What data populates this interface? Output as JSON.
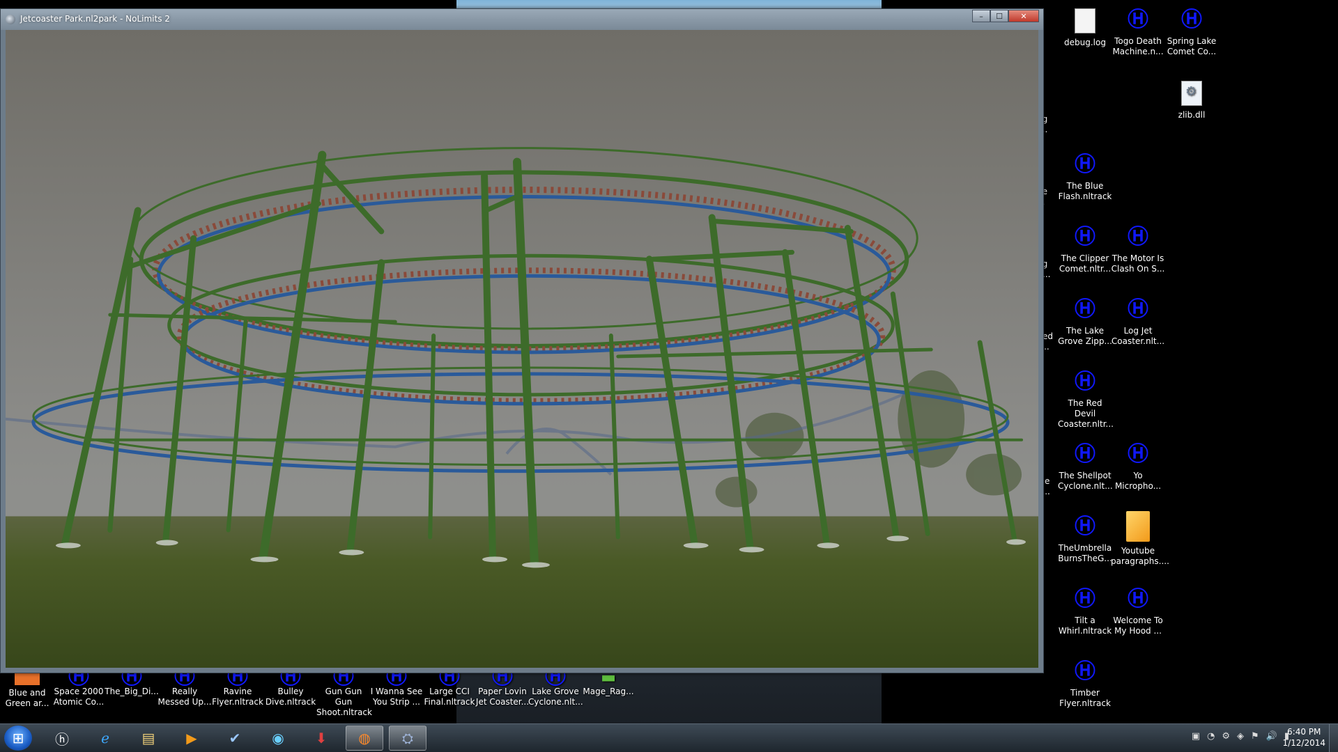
{
  "window": {
    "title": "Jetcoaster Park.nl2park - NoLimits 2",
    "controls": {
      "minimize": "–",
      "maximize": "☐",
      "close": "✕"
    }
  },
  "desktop_right": [
    {
      "label": "debug.log",
      "icon": "file-icon"
    },
    {
      "label": "Togo Death Machine.n...",
      "icon": "nltrack-icon"
    },
    {
      "label": "Spring Lake Comet Co...",
      "icon": "nltrack-icon"
    },
    {
      "label": "zlib.dll",
      "icon": "dll-icon"
    },
    {
      "label": "The Blue Flash.nltrack",
      "icon": "nltrack-icon"
    },
    {
      "label": "The Clipper Comet.nltr...",
      "icon": "nltrack-icon"
    },
    {
      "label": "The Motor Is Clash On S...",
      "icon": "nltrack-icon"
    },
    {
      "label": "The Lake Grove Zipp...",
      "icon": "nltrack-icon"
    },
    {
      "label": "Log Jet Coaster.nlt...",
      "icon": "nltrack-icon"
    },
    {
      "label": "The Red Devil Coaster.nltr...",
      "icon": "nltrack-icon"
    },
    {
      "label": "The Shellpot Cyclone.nlt...",
      "icon": "nltrack-icon"
    },
    {
      "label": "Yo Micropho...",
      "icon": "nltrack-icon"
    },
    {
      "label": "TheUmbrella BurnsTheG...",
      "icon": "nltrack-icon"
    },
    {
      "label": "Youtube paragraphs....",
      "icon": "document-icon"
    },
    {
      "label": "Tilt a Whirl.nltrack",
      "icon": "nltrack-icon"
    },
    {
      "label": "Welcome To My Hood ...",
      "icon": "nltrack-icon"
    },
    {
      "label": "Timber Flyer.nltrack",
      "icon": "nltrack-icon"
    }
  ],
  "desktop_bottom": [
    {
      "label": "Blue and Green ar...",
      "icon": "folder-orange-icon"
    },
    {
      "label": "Space 2000 Atomic Co...",
      "icon": "nltrack-icon"
    },
    {
      "label": "The_Big_Di...",
      "icon": "nltrack-icon"
    },
    {
      "label": "Really Messed Up...",
      "icon": "nltrack-icon"
    },
    {
      "label": "Ravine Flyer.nltrack",
      "icon": "nltrack-icon"
    },
    {
      "label": "Bulley Dive.nltrack",
      "icon": "nltrack-icon"
    },
    {
      "label": "Gun Gun Gun Shoot.nltrack",
      "icon": "nltrack-icon"
    },
    {
      "label": "I Wanna See You Strip ...",
      "icon": "nltrack-icon"
    },
    {
      "label": "Large CCI Final.nltrack",
      "icon": "nltrack-icon"
    },
    {
      "label": "Paper Lovin Jet Coaster...",
      "icon": "nltrack-icon"
    },
    {
      "label": "Lake Grove Cyclone.nlt...",
      "icon": "nltrack-icon"
    },
    {
      "label": "Mage_Rag...",
      "icon": "nltrack-icon"
    }
  ],
  "desktop_cutoff": [
    "ng r...",
    "ne ...",
    "ng lt...",
    "ited s...",
    "ide e..."
  ],
  "taskbar": {
    "start_glyph": "⊞",
    "pinned": [
      {
        "name": "hp-icon",
        "glyph": "ⓗ"
      },
      {
        "name": "internet-explorer-icon",
        "glyph": "ℯ"
      },
      {
        "name": "file-explorer-icon",
        "glyph": "▤"
      },
      {
        "name": "media-player-icon",
        "glyph": "▶"
      },
      {
        "name": "checkmark-app-icon",
        "glyph": "✔"
      },
      {
        "name": "browser-orb-icon",
        "glyph": "◉"
      },
      {
        "name": "download-app-icon",
        "glyph": "⬇"
      },
      {
        "name": "firefox-icon",
        "glyph": "◍"
      },
      {
        "name": "nolimits-icon",
        "glyph": "⛭"
      }
    ],
    "tray_glyphs": [
      "▣",
      "◔",
      "⚙",
      "◈",
      "⚑",
      "🔊",
      "▮"
    ],
    "time": "6:40 PM",
    "date": "1/12/2014"
  },
  "colors": {
    "coaster_green": "#3d6b2a",
    "track_blue": "#2a5a9a",
    "icon_blue": "#1018ff"
  }
}
